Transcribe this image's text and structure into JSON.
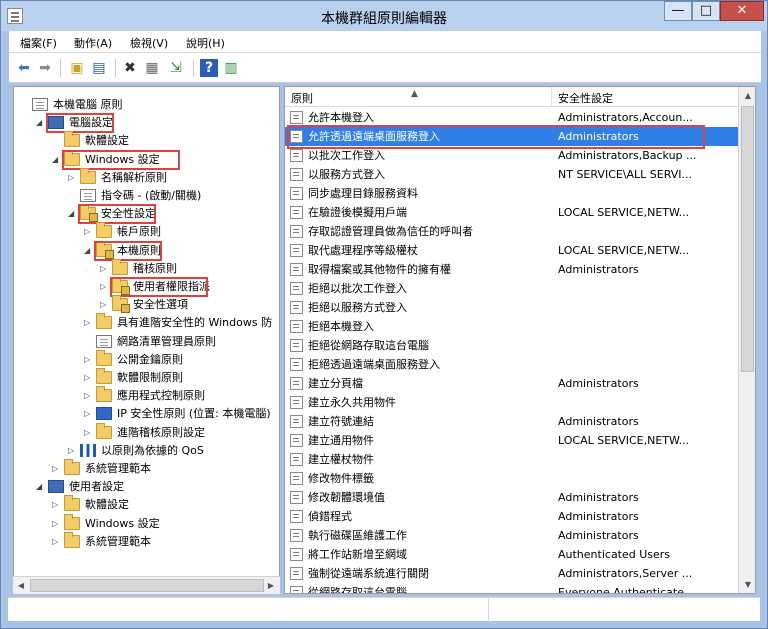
{
  "window": {
    "title": "本機群組原則編輯器"
  },
  "menus": [
    "檔案(F)",
    "動作(A)",
    "檢視(V)",
    "說明(H)"
  ],
  "toolbar": [
    "back-icon",
    "forward-icon",
    "up-folder-icon",
    "show-hide-console-tree-icon",
    "delete-icon",
    "properties-icon",
    "export-list-icon",
    "help-icon",
    "view-icon"
  ],
  "tree": [
    {
      "depth": 0,
      "label": "本機電腦 原則",
      "icon": "doc-icon",
      "toggle": ""
    },
    {
      "depth": 1,
      "label": "電腦設定",
      "icon": "computer-icon",
      "toggle": "◢",
      "boxed": true
    },
    {
      "depth": 2,
      "label": "軟體設定",
      "icon": "folder-icon",
      "toggle": ""
    },
    {
      "depth": 2,
      "label": "Windows 設定",
      "icon": "folder-icon",
      "toggle": "◢",
      "boxed": true
    },
    {
      "depth": 3,
      "label": "名稱解析原則",
      "icon": "folder-icon",
      "toggle": "▷"
    },
    {
      "depth": 3,
      "label": "指令碼 - (啟動/關機)",
      "icon": "doc-icon",
      "toggle": ""
    },
    {
      "depth": 3,
      "label": "安全性設定",
      "icon": "lock-folder-icon",
      "toggle": "◢",
      "boxed": true
    },
    {
      "depth": 4,
      "label": "帳戶原則",
      "icon": "folder-icon",
      "toggle": "▷"
    },
    {
      "depth": 4,
      "label": "本機原則",
      "icon": "lock-folder-icon",
      "toggle": "◢",
      "boxed": true
    },
    {
      "depth": 5,
      "label": "稽核原則",
      "icon": "folder-icon",
      "toggle": "▷"
    },
    {
      "depth": 5,
      "label": "使用者權限指派",
      "icon": "lock-folder-icon",
      "toggle": "▷",
      "boxed": true
    },
    {
      "depth": 5,
      "label": "安全性選項",
      "icon": "lock-folder-icon",
      "toggle": "▷"
    },
    {
      "depth": 4,
      "label": "具有進階安全性的 Windows 防",
      "icon": "folder-icon",
      "toggle": "▷"
    },
    {
      "depth": 4,
      "label": "網路清單管理員原則",
      "icon": "doc-icon",
      "toggle": ""
    },
    {
      "depth": 4,
      "label": "公開金鑰原則",
      "icon": "folder-icon",
      "toggle": "▷"
    },
    {
      "depth": 4,
      "label": "軟體限制原則",
      "icon": "folder-icon",
      "toggle": "▷"
    },
    {
      "depth": 4,
      "label": "應用程式控制原則",
      "icon": "folder-icon",
      "toggle": "▷"
    },
    {
      "depth": 4,
      "label": "IP 安全性原則 (位置: 本機電腦)",
      "icon": "shield-icon",
      "toggle": "▷"
    },
    {
      "depth": 4,
      "label": "進階稽核原則設定",
      "icon": "folder-icon",
      "toggle": "▷"
    },
    {
      "depth": 3,
      "label": "以原則為依據的 QoS",
      "icon": "chart-icon",
      "toggle": "▷"
    },
    {
      "depth": 2,
      "label": "系統管理範本",
      "icon": "folder-icon",
      "toggle": "▷"
    },
    {
      "depth": 1,
      "label": "使用者設定",
      "icon": "user-icon",
      "toggle": "◢"
    },
    {
      "depth": 2,
      "label": "軟體設定",
      "icon": "folder-icon",
      "toggle": "▷"
    },
    {
      "depth": 2,
      "label": "Windows 設定",
      "icon": "folder-icon",
      "toggle": "▷"
    },
    {
      "depth": 2,
      "label": "系統管理範本",
      "icon": "folder-icon",
      "toggle": "▷"
    }
  ],
  "columns": {
    "policy": "原則",
    "setting": "安全性設定"
  },
  "policies": [
    {
      "name": "允許本機登入",
      "setting": "Administrators,Accoun..."
    },
    {
      "name": "允許透過遠端桌面服務登入",
      "setting": "Administrators",
      "selected": true
    },
    {
      "name": "以批次工作登入",
      "setting": "Administrators,Backup ..."
    },
    {
      "name": "以服務方式登入",
      "setting": "NT SERVICE\\ALL SERVI..."
    },
    {
      "name": "同步處理目錄服務資料",
      "setting": ""
    },
    {
      "name": "在驗證後模擬用戶端",
      "setting": "LOCAL SERVICE,NETW..."
    },
    {
      "name": "存取認證管理員做為信任的呼叫者",
      "setting": ""
    },
    {
      "name": "取代處理程序等級權杖",
      "setting": "LOCAL SERVICE,NETW..."
    },
    {
      "name": "取得檔案或其他物件的擁有權",
      "setting": "Administrators"
    },
    {
      "name": "拒絕以批次工作登入",
      "setting": ""
    },
    {
      "name": "拒絕以服務方式登入",
      "setting": ""
    },
    {
      "name": "拒絕本機登入",
      "setting": ""
    },
    {
      "name": "拒絕從網路存取這台電腦",
      "setting": ""
    },
    {
      "name": "拒絕透過遠端桌面服務登入",
      "setting": ""
    },
    {
      "name": "建立分頁檔",
      "setting": "Administrators"
    },
    {
      "name": "建立永久共用物件",
      "setting": ""
    },
    {
      "name": "建立符號連結",
      "setting": "Administrators"
    },
    {
      "name": "建立通用物件",
      "setting": "LOCAL SERVICE,NETW..."
    },
    {
      "name": "建立權杖物件",
      "setting": ""
    },
    {
      "name": "修改物件標籤",
      "setting": ""
    },
    {
      "name": "修改韌體環境值",
      "setting": "Administrators"
    },
    {
      "name": "偵錯程式",
      "setting": "Administrators"
    },
    {
      "name": "執行磁碟區維護工作",
      "setting": "Administrators"
    },
    {
      "name": "將工作站新增至網域",
      "setting": "Authenticated Users"
    },
    {
      "name": "強制從遠端系統進行關閉",
      "setting": "Administrators,Server ..."
    },
    {
      "name": "從網路存取這台電腦",
      "setting": "Everyone,Authenticate..."
    }
  ]
}
